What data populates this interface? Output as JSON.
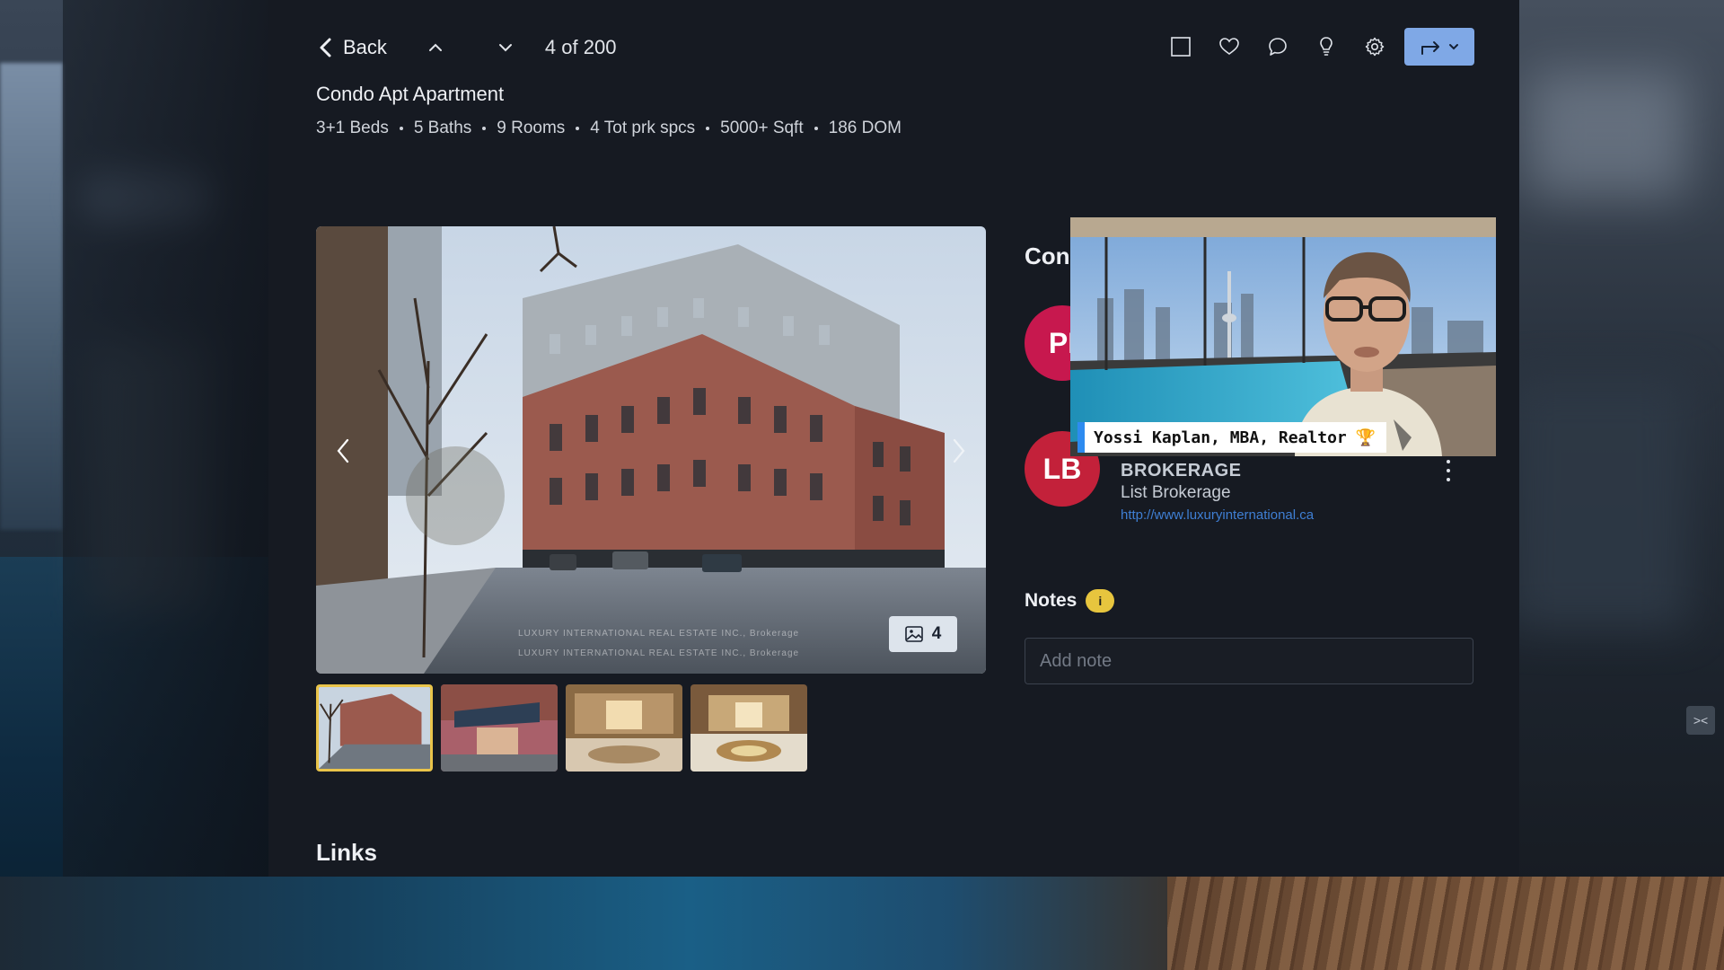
{
  "header": {
    "back_label": "Back",
    "counter": "4 of 200"
  },
  "listing": {
    "title": "Condo Apt Apartment",
    "specs": [
      "3+1 Beds",
      "5 Baths",
      "9 Rooms",
      "4 Tot prk spcs",
      "5000+ Sqft",
      "186 DOM"
    ]
  },
  "gallery": {
    "photo_count": "4",
    "watermark_line1": "LUXURY INTERNATIONAL REAL ESTATE INC., Brokerage",
    "watermark_line2": "LUXURY INTERNATIONAL REAL ESTATE INC., Brokerage",
    "thumbnails": [
      "Building exterior",
      "Entrance canopy",
      "Lobby",
      "Lobby hall"
    ]
  },
  "contacts": {
    "heading": "Con",
    "agent_initials": "PI",
    "brokerage_initials": "LB",
    "brokerage_name": "BROKERAGE",
    "brokerage_role": "List Brokerage",
    "brokerage_url": "http://www.luxuryinternational.ca"
  },
  "notes": {
    "heading": "Notes",
    "badge": "i",
    "placeholder": "Add note"
  },
  "links": {
    "heading": "Links"
  },
  "webcam": {
    "caption": "Yossi Kaplan, MBA, Realtor",
    "caption_icon": "🏆"
  },
  "colors": {
    "panel_bg": "#161a22",
    "accent_blue": "#7fa8e6",
    "link_blue": "#3f7fd4",
    "thumb_active": "#e9c44a",
    "avatar_pink": "#c7184e",
    "avatar_red": "#c3213a",
    "notes_badge": "#e7c53e"
  },
  "icons": {
    "back": "chevron-left-icon",
    "prev": "chevron-up-icon",
    "next": "chevron-down-icon",
    "select": "checkbox-icon",
    "favorite": "heart-icon",
    "comment": "comment-icon",
    "insight": "lightbulb-icon",
    "settings": "gear-icon",
    "share": "share-arrow-icon",
    "photos": "image-icon"
  }
}
